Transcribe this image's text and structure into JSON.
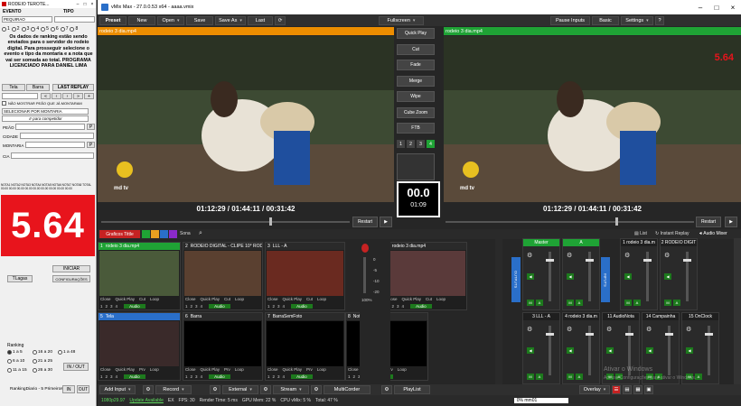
{
  "left_app": {
    "title": "RODEIO TEROTE...",
    "evento_label": "EVENTO",
    "tipo_label": "TIPO",
    "evento_value": "PEQUIRAO",
    "tipo_value": "",
    "radios": [
      "1",
      "2",
      "3",
      "4",
      "5",
      "6",
      "7",
      "8"
    ],
    "notice": "Os dados de ranking estão sendo enviados para o servidor do rodeio digital. Para prosseguir selecione o evento e tipo da montaria e a nota que vai ser somada ao total. PROGRAMA LICENCIADO PARA DANIEL LIMA",
    "tabs": [
      "Tela",
      "Barra",
      "LAST REPLAY"
    ],
    "checkbox_label": "NÃO MOSTRAR PEÃO QUE JÁ MONTARAM",
    "select_montaria": "SELECIONAR POR MONTARIA",
    "competidor_hint": "Ir para competidor",
    "peao_label": "PEÃO",
    "cidade_label": "CIDADE",
    "montaria_label": "MONTARIA",
    "cia_label": "CIA",
    "notas_header": "NOTA1  NOTA2  NOTA3  NOTA4  NOTA5  NOTA6  NOTA7  NOTA8  TOTAL",
    "notas_values": "00.00  00.00  00.00  00.00  00.00  00.00  00.00  00.00  00.00",
    "score": "5.64",
    "iniciar": "INICIAR",
    "tlagas": "TLagas",
    "config": "CONFIGURAÇÕES",
    "ranking_label": "Ranking",
    "ranking_opts": [
      "1 a 5",
      "16 a 20",
      "1 a 48",
      "6 a 10",
      "21 a 25",
      "11 a 15",
      "26 a 30"
    ],
    "in_out": "IN / OUT",
    "ranking_diario": "RankingDiario  - 5 Primeiros",
    "btn_in": "IN",
    "btn_out": "OUT"
  },
  "vmix": {
    "title": "vMix Max - 27.0.0.53 x64 - aaaa.vmix",
    "menu": [
      "Preset",
      "New",
      "Open",
      "Save",
      "Save As",
      "Last"
    ],
    "fullscreen": "Fullscreen",
    "right_menu": [
      "Pause Inputs",
      "Basic",
      "Settings"
    ],
    "preview_title": "rodeio 3 dia.mp4",
    "output_title": "rodeio 3 dia.mp4",
    "preview_timecode": "01:12:29  /  01:44:11  /  00:31:42",
    "output_timecode": "01:12:29  /  01:44:11  /  00:31:42",
    "transitions": [
      "Quick Play",
      "Cut",
      "Fade",
      "Merge",
      "Wipe",
      "Cube Zoom",
      "FTB"
    ],
    "trans_nums": [
      "1",
      "2",
      "3",
      "4"
    ],
    "t_bar": "00.0",
    "t_time": "01:09",
    "restart": "Restart",
    "score_overlay": "5.64",
    "graficos": "Graficos Tittle",
    "sona": "Sona",
    "list": "List",
    "instant_replay": "Instant Replay",
    "audio_mixer": "Audio Mixer",
    "inputs": [
      {
        "num": "1",
        "name": "rodeio 3 dia.mp4"
      },
      {
        "num": "2",
        "name": "RODEIO DIGITAL - CLIPE 10° RODE"
      },
      {
        "num": "3",
        "name": "LLL - A"
      },
      {
        "num": "4",
        "name": "rodeio 3 dia.mp4"
      },
      {
        "num": "5",
        "name": "Tela"
      },
      {
        "num": "6",
        "name": "Barra"
      },
      {
        "num": "7",
        "name": "BarraSemFoto"
      },
      {
        "num": "8",
        "name": "Nota"
      }
    ],
    "tile_actions": [
      "Close",
      "Quick Play",
      "Cut",
      "Loop"
    ],
    "tile_actions2": [
      "Close",
      "Quick Play",
      "Prv",
      "Loop"
    ],
    "audio_label": "Audio",
    "mixer_top": [
      {
        "name": "Master"
      },
      {
        "name": "A"
      },
      {
        "name": "1 rodeio 3 dia.m"
      },
      {
        "name": "2 RODEIO DIGIT"
      }
    ],
    "mixer_bottom": [
      {
        "name": "3 LLL - A"
      },
      {
        "name": "4 rodeio 3 dia.m"
      },
      {
        "name": "11 AudioNota"
      },
      {
        "name": "14 Campainha"
      },
      {
        "name": "15 OnClock"
      }
    ],
    "vu_ticks": [
      "0",
      "-5",
      "-10",
      "-20"
    ],
    "percent": "100%",
    "outputs_label": "OUTPUTS",
    "inputs_label": "INPUTS",
    "bottom_bar": [
      "Add Input",
      "Record",
      "External",
      "Stream",
      "MultiCorder",
      "PlayList",
      "Overlay"
    ],
    "watermark1": "Ativar o Windows",
    "watermark2": "Acesse Configurações para ativar o Windows.",
    "status": {
      "res": "1080p29.97",
      "update": "Update Available",
      "ex": "EX",
      "fps": "FPS: 30",
      "render": "Render Time: 5 ms",
      "gpu": "GPU Mem: 22 %",
      "cpu": "CPU vMix: 5 %",
      "total": "Total: 47 %",
      "search": "0%  mm01"
    }
  },
  "colors": {
    "preview_bar": "#ec8d00",
    "output_bar": "#1fa335",
    "score_red": "#e8141c",
    "accent_blue": "#2a6fc9"
  }
}
